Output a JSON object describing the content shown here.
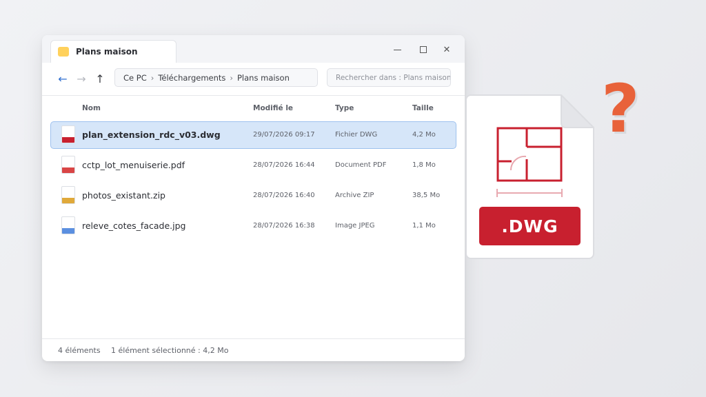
{
  "window": {
    "tab_title": "Plans maison",
    "controls": {
      "minimize": "minimize-icon",
      "maximize": "maximize-icon",
      "close": "close-icon"
    }
  },
  "navigation": {
    "back_icon": "arrow-left-icon",
    "back_glyph": "←",
    "forward_icon": "arrow-right-icon",
    "forward_glyph": "→",
    "up_icon": "arrow-up-icon",
    "up_glyph": "↑",
    "close_glyph": "✕"
  },
  "breadcrumb": [
    "Ce PC",
    "Téléchargements",
    "Plans maison"
  ],
  "breadcrumb_separator": "›",
  "search": {
    "placeholder": "Rechercher dans : Plans maison"
  },
  "columns": {
    "name": "Nom",
    "modified": "Modifié le",
    "type": "Type",
    "size": "Taille"
  },
  "files": [
    {
      "name": "plan_extension_rdc_v03.dwg",
      "modified": "29/07/2026 09:17",
      "type": "Fichier DWG",
      "size": "4,2 Mo",
      "selected": true,
      "color": "#c8202f"
    },
    {
      "name": "cctp_lot_menuiserie.pdf",
      "modified": "28/07/2026 16:44",
      "type": "Document PDF",
      "size": "1,8 Mo",
      "selected": false,
      "color": "#d94545"
    },
    {
      "name": "photos_existant.zip",
      "modified": "28/07/2026 16:40",
      "type": "Archive ZIP",
      "size": "38,5 Mo",
      "selected": false,
      "color": "#e0a93a"
    },
    {
      "name": "releve_cotes_facade.jpg",
      "modified": "28/07/2026 16:38",
      "type": "Image JPEG",
      "size": "1,1 Mo",
      "selected": false,
      "color": "#5b8fe0"
    }
  ],
  "status": {
    "count": "4 éléments",
    "selection": "1 élément sélectionné : 4,2 Mo"
  },
  "illustration": {
    "extension_label": ".DWG",
    "question_mark": "?",
    "accent_color": "#c8202f",
    "question_color": "#e8623a"
  }
}
